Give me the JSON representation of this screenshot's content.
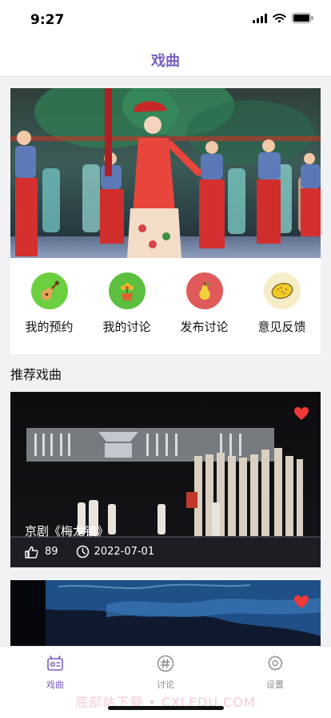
{
  "status": {
    "time": "9:27"
  },
  "nav": {
    "title": "戏曲"
  },
  "quick_actions": [
    {
      "label": "我的预约",
      "icon": "guitar-icon",
      "color": "#6ccf3f"
    },
    {
      "label": "我的讨论",
      "icon": "flower-pot-icon",
      "color": "#5cbf3f"
    },
    {
      "label": "发布讨论",
      "icon": "pear-icon",
      "color": "#e05a5a"
    },
    {
      "label": "意见反馈",
      "icon": "lemon-icon",
      "color": "#f6ecc8"
    }
  ],
  "section": {
    "title": "推荐戏曲"
  },
  "cards": [
    {
      "title": "京剧《梅龙镇》",
      "likes": "89",
      "date": "2022-07-01",
      "favorited": true
    },
    {
      "favorited": true
    }
  ],
  "tabs": [
    {
      "label": "戏曲",
      "icon": "opera-tab-icon",
      "active": true
    },
    {
      "label": "讨论",
      "icon": "hashtag-icon",
      "active": false
    },
    {
      "label": "设置",
      "icon": "gear-icon",
      "active": false
    }
  ],
  "colors": {
    "accent": "#7a5fc0",
    "inactive": "#8e8e93"
  },
  "watermark": "底部站下载 • CXLEDU.COM"
}
